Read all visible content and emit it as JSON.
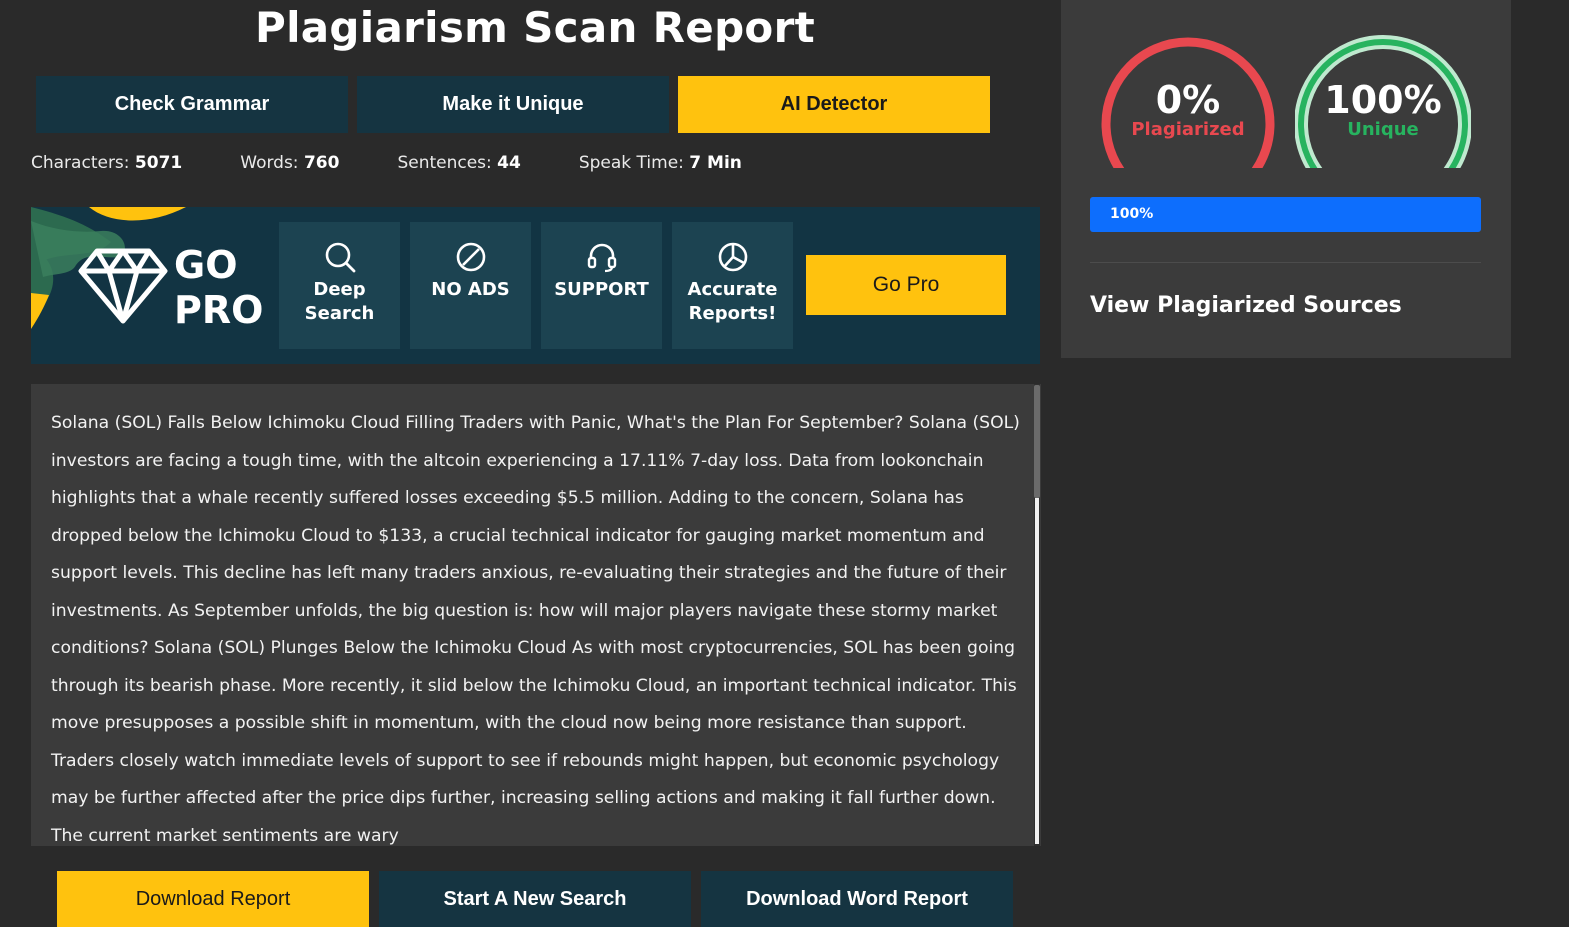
{
  "page": {
    "title": "Plagiarism Scan Report"
  },
  "tools": [
    {
      "label": "Check Grammar",
      "active": false
    },
    {
      "label": "Make it Unique",
      "active": false
    },
    {
      "label": "AI Detector",
      "active": true
    }
  ],
  "stats": {
    "characters": {
      "label": "Characters:",
      "value": "5071"
    },
    "words": {
      "label": "Words:",
      "value": "760"
    },
    "sentences": {
      "label": "Sentences:",
      "value": "44"
    },
    "speak_time": {
      "label": "Speak Time:",
      "value": "7 Min"
    }
  },
  "gopro": {
    "title_line1": "GO",
    "title_line2": "PRO",
    "features": [
      {
        "icon": "search-icon",
        "label": "Deep\nSearch"
      },
      {
        "icon": "no-ads-icon",
        "label": "NO ADS"
      },
      {
        "icon": "headset-icon",
        "label": "SUPPORT"
      },
      {
        "icon": "pie-chart-icon",
        "label": "Accurate\nReports!"
      }
    ],
    "button_label": "Go Pro"
  },
  "document": {
    "text": "Solana (SOL) Falls Below Ichimoku Cloud Filling Traders with Panic, What's the Plan For September? Solana (SOL) investors are facing a tough time, with the altcoin experiencing a 17.11% 7-day loss. Data from lookonchain highlights that a whale recently suffered losses exceeding $5.5 million. Adding to the concern, Solana has dropped below the Ichimoku Cloud to $133, a crucial technical indicator for gauging market momentum and support levels. This decline has left many traders anxious, re-evaluating their strategies and the future of their investments. As September unfolds, the big question is: how will major players navigate these stormy market conditions? Solana (SOL) Plunges Below the Ichimoku Cloud As with most cryptocurrencies, SOL has been going through its bearish phase. More recently, it slid below the Ichimoku Cloud, an important technical indicator. This move presupposes a possible shift in momentum, with the cloud now being more resistance than support. Traders closely watch immediate levels of support to see if rebounds might happen, but economic psychology may be further affected after the price dips further, increasing selling actions and making it fall further down. The current market sentiments are wary"
  },
  "actions": {
    "download_report": "Download Report",
    "new_search": "Start A New Search",
    "download_word": "Download Word Report"
  },
  "results": {
    "plagiarized": {
      "value": "0%",
      "label": "Plagiarized",
      "fraction": 0,
      "color": "#e8484f",
      "track_color": "#f2c6c8"
    },
    "unique": {
      "value": "100%",
      "label": "Unique",
      "fraction": 1,
      "color": "#27b35f",
      "track_color": "#bfe9cf"
    },
    "progress": {
      "text": "100%",
      "fraction": 1
    },
    "sources_link": "View Plagiarized Sources"
  }
}
